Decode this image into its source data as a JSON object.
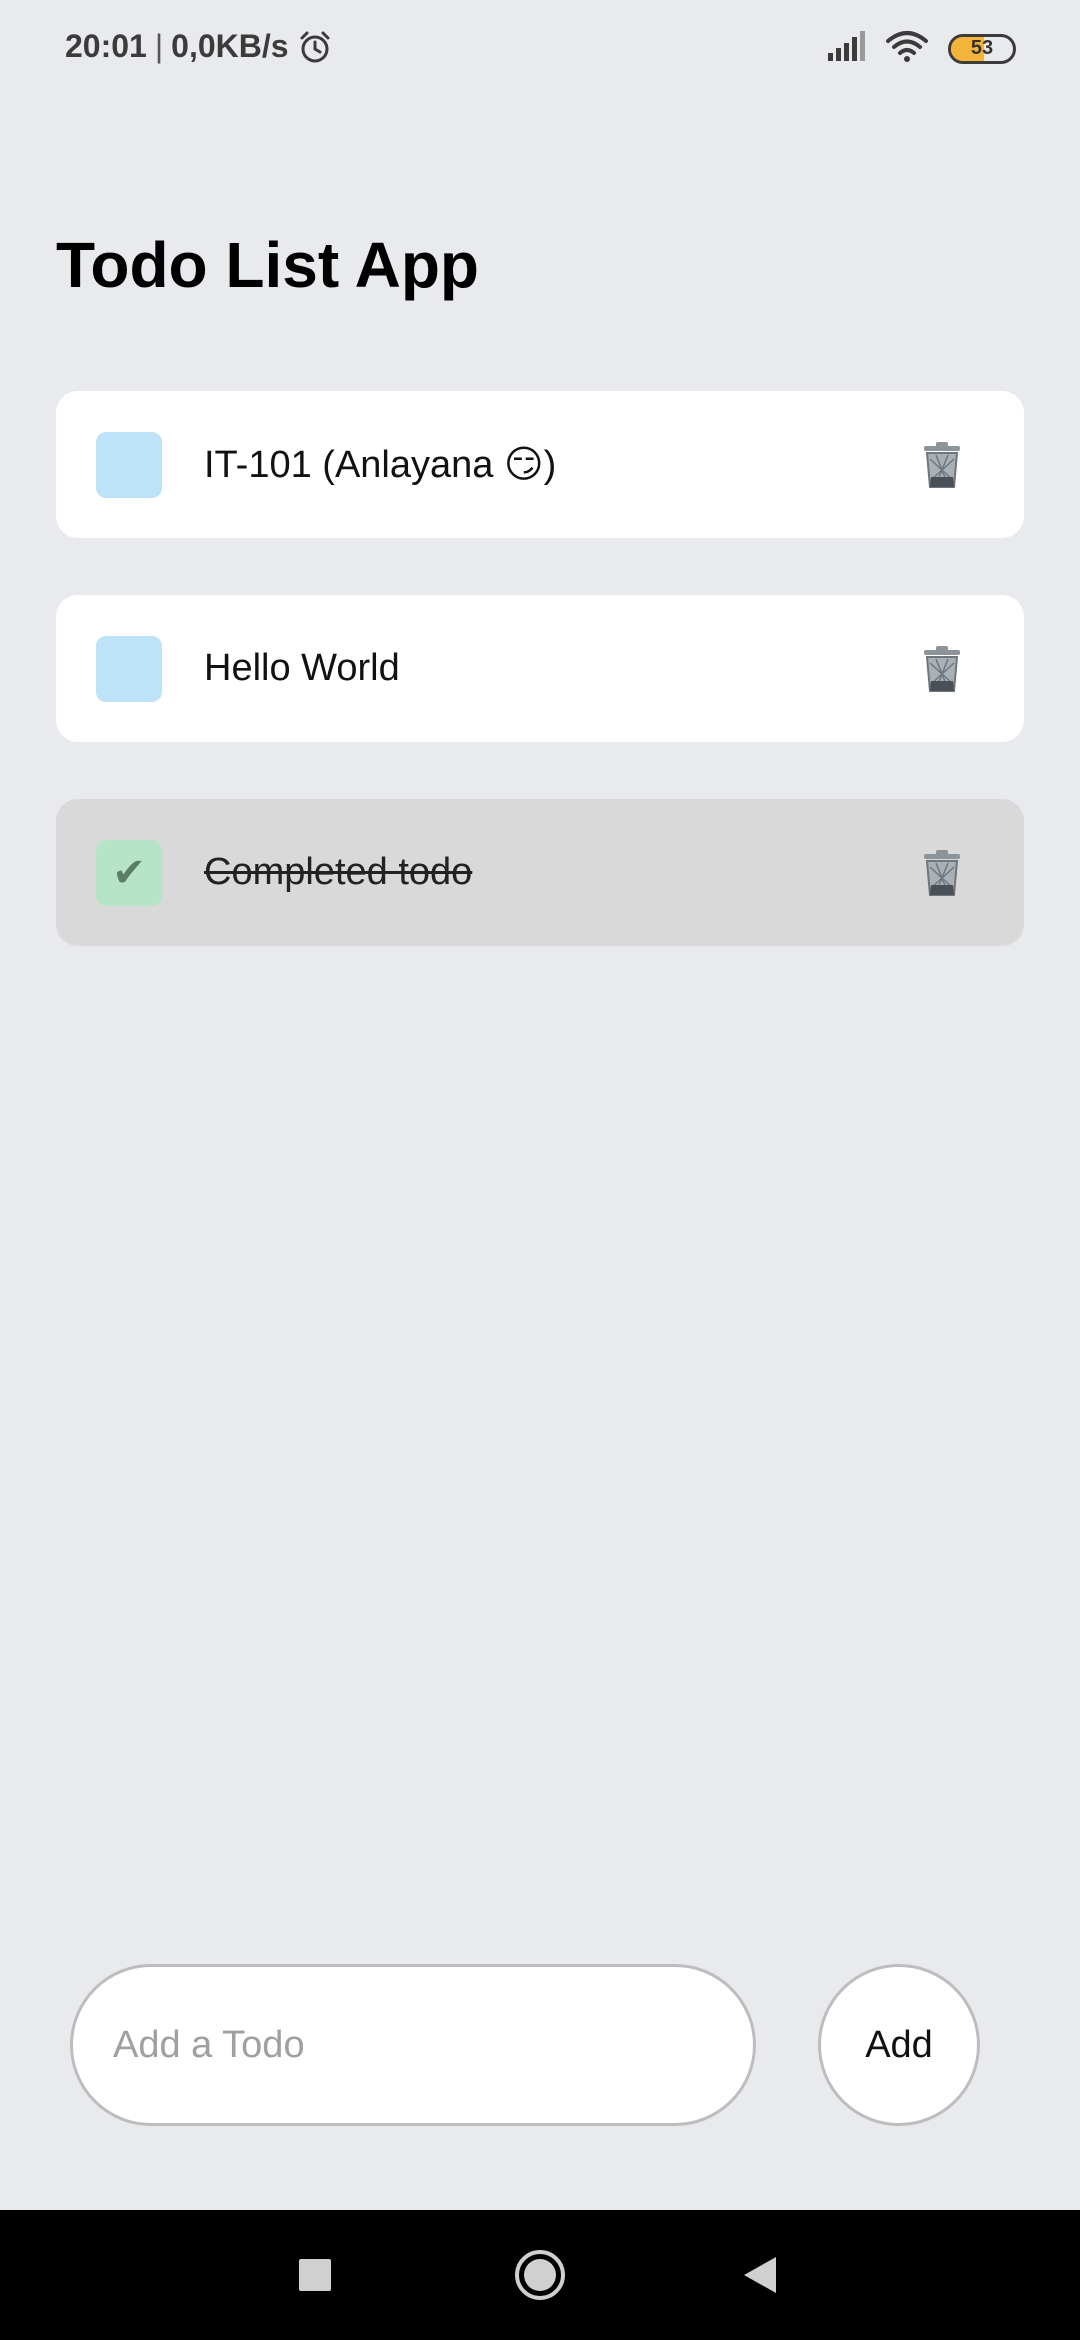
{
  "status_bar": {
    "time": "20:01",
    "separator": "|",
    "speed": "0,0KB/s",
    "battery_level": "53",
    "battery_fraction": 0.53,
    "icons": [
      "alarm-icon",
      "signal-icon",
      "wifi-icon",
      "battery-icon"
    ]
  },
  "app": {
    "title": "Todo List App"
  },
  "todos": [
    {
      "text": "IT-101 (Anlayana 😏)",
      "completed": false
    },
    {
      "text": "Hello World",
      "completed": false
    },
    {
      "text": "Completed todo",
      "completed": true
    }
  ],
  "todo_check_glyph": "✔",
  "input": {
    "placeholder": "Add a Todo",
    "value": ""
  },
  "add_button": {
    "label": "Add"
  },
  "colors": {
    "background": "#E8EAED",
    "card": "#FFFFFF",
    "card_completed": "#D9D9D9",
    "checkbox_unchecked": "#BEE3F8",
    "checkbox_checked": "#B7E4C7",
    "battery_fill": "#F4B43A"
  },
  "nav": {
    "icons": [
      "recents-square-icon",
      "home-circle-icon",
      "back-triangle-icon"
    ]
  }
}
